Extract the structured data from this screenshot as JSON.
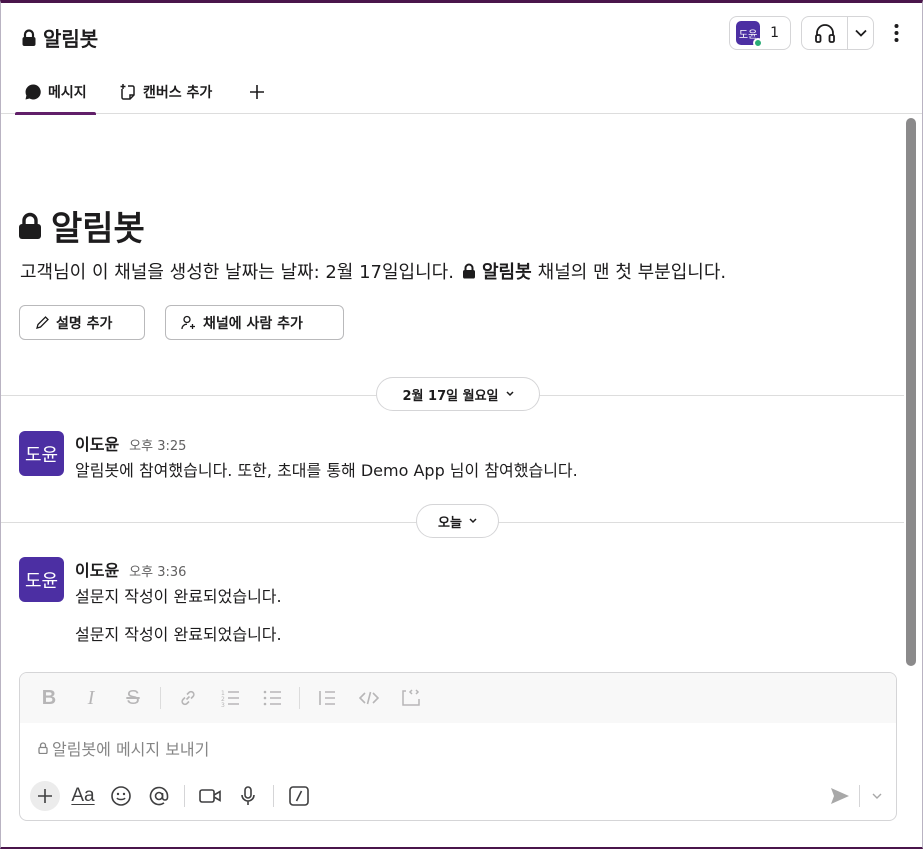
{
  "header": {
    "channel_name": "알림봇",
    "member_count": "1",
    "member_avatar_text": "도윤"
  },
  "tabs": {
    "messages": "메시지",
    "canvas": "캔버스 추가"
  },
  "intro": {
    "title": "알림봇",
    "text_before": "고객님이 이 채널을 생성한 날짜는 날짜: 2월 17일입니다.",
    "channel_bold": "알림봇",
    "text_after": "채널의 맨 첫 부분입니다.",
    "add_description": "설명 추가",
    "add_people": "채널에 사람 추가"
  },
  "dividers": [
    {
      "label": "2월 17일 월요일"
    },
    {
      "label": "오늘"
    }
  ],
  "messages": [
    {
      "avatar_text": "도윤",
      "name": "이도윤",
      "time": "오후 3:25",
      "lines": [
        "알림봇에 참여했습니다. 또한, 초대를 통해 Demo App 님이 참여했습니다."
      ]
    },
    {
      "avatar_text": "도윤",
      "name": "이도윤",
      "time": "오후 3:36",
      "lines": [
        "설문지 작성이 완료되었습니다.",
        "설문지 작성이 완료되었습니다."
      ]
    }
  ],
  "composer": {
    "placeholder": "알림봇에 메시지 보내기",
    "format_label": "Aa"
  },
  "colors": {
    "brand": "#4a154b",
    "accent": "#611f69",
    "avatar": "#4c2fa3",
    "presence": "#2bac76"
  }
}
